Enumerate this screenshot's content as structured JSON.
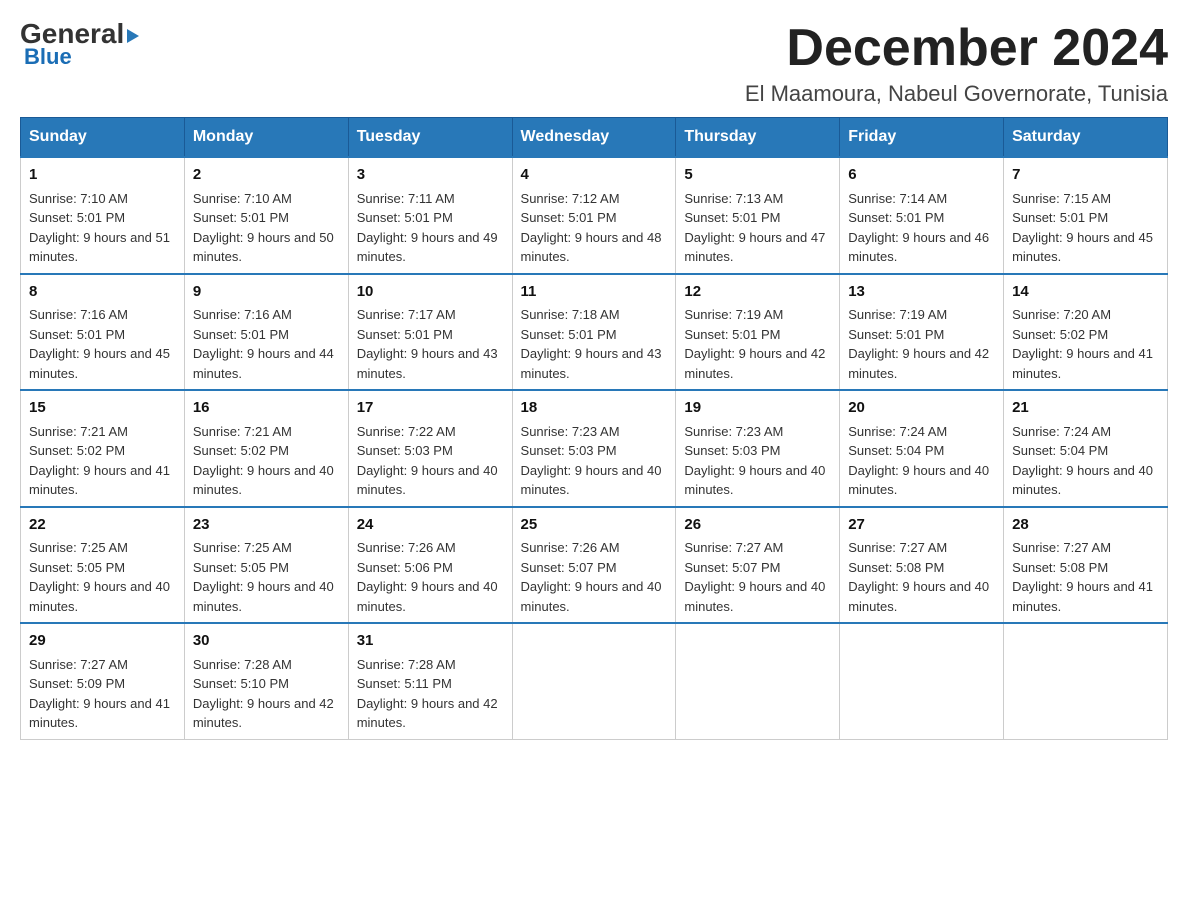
{
  "header": {
    "logo": {
      "line1": "General",
      "line2": "Blue"
    },
    "month": "December 2024",
    "location": "El Maamoura, Nabeul Governorate, Tunisia"
  },
  "weekdays": [
    "Sunday",
    "Monday",
    "Tuesday",
    "Wednesday",
    "Thursday",
    "Friday",
    "Saturday"
  ],
  "weeks": [
    [
      {
        "day": "1",
        "sunrise": "7:10 AM",
        "sunset": "5:01 PM",
        "daylight": "9 hours and 51 minutes."
      },
      {
        "day": "2",
        "sunrise": "7:10 AM",
        "sunset": "5:01 PM",
        "daylight": "9 hours and 50 minutes."
      },
      {
        "day": "3",
        "sunrise": "7:11 AM",
        "sunset": "5:01 PM",
        "daylight": "9 hours and 49 minutes."
      },
      {
        "day": "4",
        "sunrise": "7:12 AM",
        "sunset": "5:01 PM",
        "daylight": "9 hours and 48 minutes."
      },
      {
        "day": "5",
        "sunrise": "7:13 AM",
        "sunset": "5:01 PM",
        "daylight": "9 hours and 47 minutes."
      },
      {
        "day": "6",
        "sunrise": "7:14 AM",
        "sunset": "5:01 PM",
        "daylight": "9 hours and 46 minutes."
      },
      {
        "day": "7",
        "sunrise": "7:15 AM",
        "sunset": "5:01 PM",
        "daylight": "9 hours and 45 minutes."
      }
    ],
    [
      {
        "day": "8",
        "sunrise": "7:16 AM",
        "sunset": "5:01 PM",
        "daylight": "9 hours and 45 minutes."
      },
      {
        "day": "9",
        "sunrise": "7:16 AM",
        "sunset": "5:01 PM",
        "daylight": "9 hours and 44 minutes."
      },
      {
        "day": "10",
        "sunrise": "7:17 AM",
        "sunset": "5:01 PM",
        "daylight": "9 hours and 43 minutes."
      },
      {
        "day": "11",
        "sunrise": "7:18 AM",
        "sunset": "5:01 PM",
        "daylight": "9 hours and 43 minutes."
      },
      {
        "day": "12",
        "sunrise": "7:19 AM",
        "sunset": "5:01 PM",
        "daylight": "9 hours and 42 minutes."
      },
      {
        "day": "13",
        "sunrise": "7:19 AM",
        "sunset": "5:01 PM",
        "daylight": "9 hours and 42 minutes."
      },
      {
        "day": "14",
        "sunrise": "7:20 AM",
        "sunset": "5:02 PM",
        "daylight": "9 hours and 41 minutes."
      }
    ],
    [
      {
        "day": "15",
        "sunrise": "7:21 AM",
        "sunset": "5:02 PM",
        "daylight": "9 hours and 41 minutes."
      },
      {
        "day": "16",
        "sunrise": "7:21 AM",
        "sunset": "5:02 PM",
        "daylight": "9 hours and 40 minutes."
      },
      {
        "day": "17",
        "sunrise": "7:22 AM",
        "sunset": "5:03 PM",
        "daylight": "9 hours and 40 minutes."
      },
      {
        "day": "18",
        "sunrise": "7:23 AM",
        "sunset": "5:03 PM",
        "daylight": "9 hours and 40 minutes."
      },
      {
        "day": "19",
        "sunrise": "7:23 AM",
        "sunset": "5:03 PM",
        "daylight": "9 hours and 40 minutes."
      },
      {
        "day": "20",
        "sunrise": "7:24 AM",
        "sunset": "5:04 PM",
        "daylight": "9 hours and 40 minutes."
      },
      {
        "day": "21",
        "sunrise": "7:24 AM",
        "sunset": "5:04 PM",
        "daylight": "9 hours and 40 minutes."
      }
    ],
    [
      {
        "day": "22",
        "sunrise": "7:25 AM",
        "sunset": "5:05 PM",
        "daylight": "9 hours and 40 minutes."
      },
      {
        "day": "23",
        "sunrise": "7:25 AM",
        "sunset": "5:05 PM",
        "daylight": "9 hours and 40 minutes."
      },
      {
        "day": "24",
        "sunrise": "7:26 AM",
        "sunset": "5:06 PM",
        "daylight": "9 hours and 40 minutes."
      },
      {
        "day": "25",
        "sunrise": "7:26 AM",
        "sunset": "5:07 PM",
        "daylight": "9 hours and 40 minutes."
      },
      {
        "day": "26",
        "sunrise": "7:27 AM",
        "sunset": "5:07 PM",
        "daylight": "9 hours and 40 minutes."
      },
      {
        "day": "27",
        "sunrise": "7:27 AM",
        "sunset": "5:08 PM",
        "daylight": "9 hours and 40 minutes."
      },
      {
        "day": "28",
        "sunrise": "7:27 AM",
        "sunset": "5:08 PM",
        "daylight": "9 hours and 41 minutes."
      }
    ],
    [
      {
        "day": "29",
        "sunrise": "7:27 AM",
        "sunset": "5:09 PM",
        "daylight": "9 hours and 41 minutes."
      },
      {
        "day": "30",
        "sunrise": "7:28 AM",
        "sunset": "5:10 PM",
        "daylight": "9 hours and 42 minutes."
      },
      {
        "day": "31",
        "sunrise": "7:28 AM",
        "sunset": "5:11 PM",
        "daylight": "9 hours and 42 minutes."
      },
      null,
      null,
      null,
      null
    ]
  ]
}
